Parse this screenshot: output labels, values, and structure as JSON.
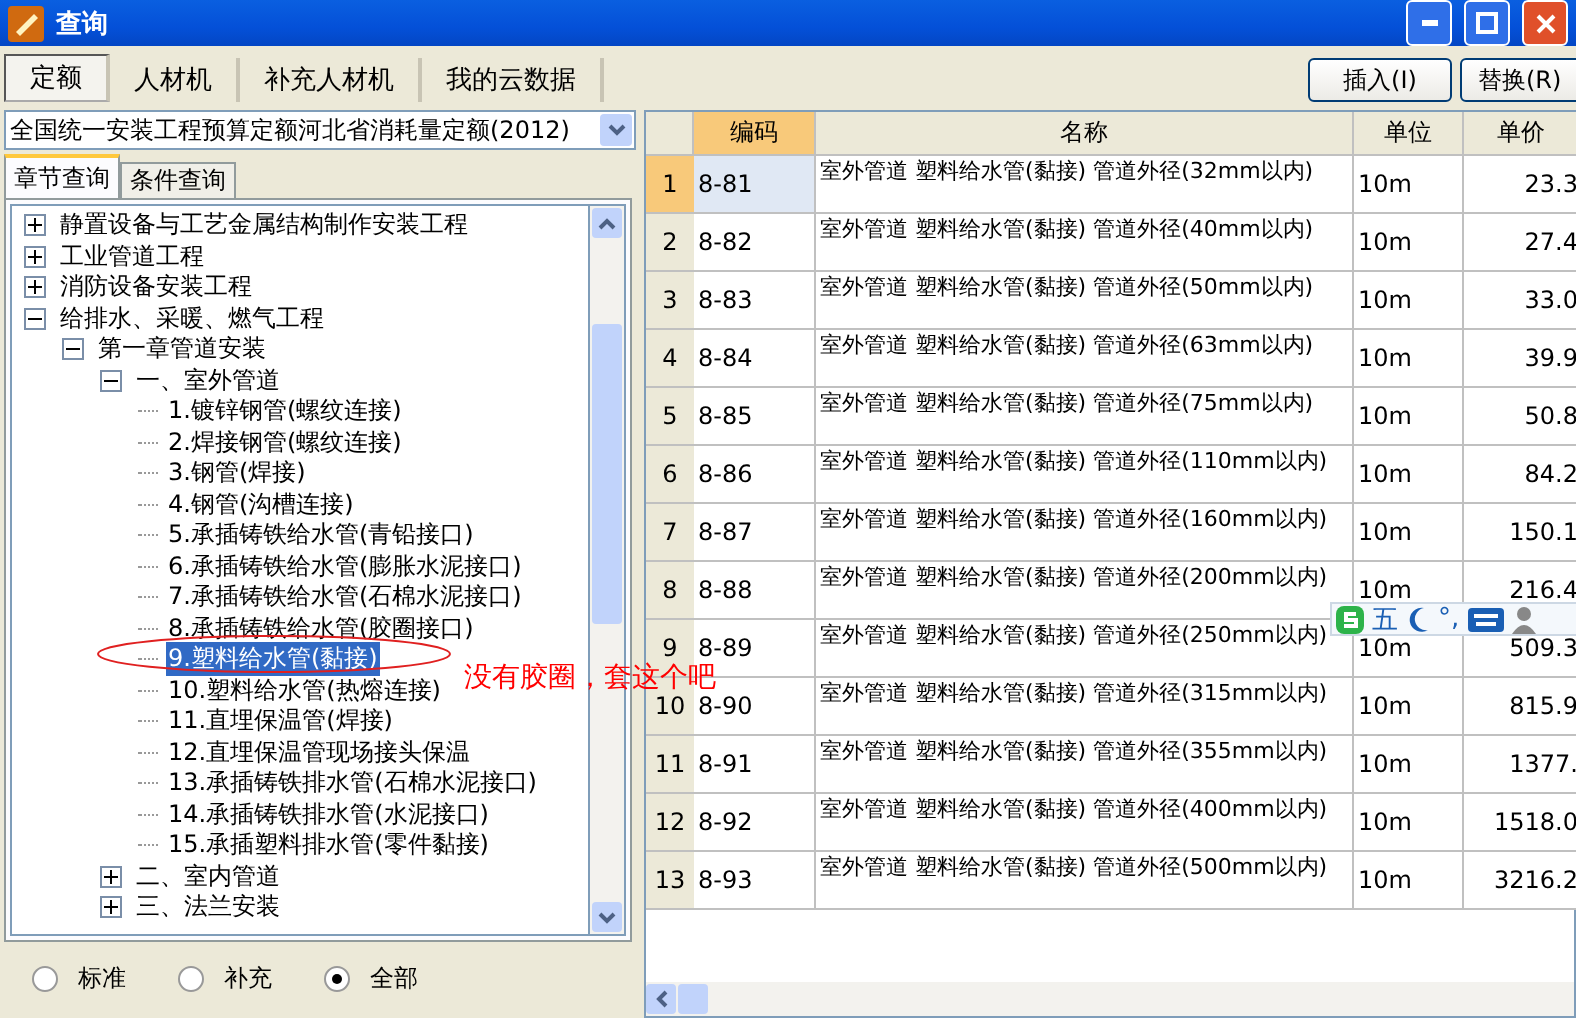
{
  "window": {
    "title": "查询"
  },
  "top_tabs": [
    {
      "label": "定额",
      "selected": true
    },
    {
      "label": "人材机",
      "selected": false
    },
    {
      "label": "补充人材机",
      "selected": false
    },
    {
      "label": "我的云数据",
      "selected": false
    }
  ],
  "buttons": [
    "插入(I)",
    "替换(R)"
  ],
  "quota_select": {
    "value": "全国统一安装工程预算定额河北省消耗量定额(2012)"
  },
  "sub_tabs": [
    {
      "label": "章节查询",
      "selected": true
    },
    {
      "label": "条件查询",
      "selected": false
    }
  ],
  "tree": [
    {
      "label": "静置设备与工艺金属结构制作安装工程",
      "expanded": false,
      "selected": false
    },
    {
      "label": "工业管道工程",
      "expanded": false,
      "selected": false
    },
    {
      "label": "消防设备安装工程",
      "expanded": false,
      "selected": false
    },
    {
      "label": "给排水、采暖、燃气工程",
      "expanded": true,
      "selected": false,
      "children": [
        {
          "label": "第一章管道安装",
          "expanded": true,
          "selected": false,
          "children": [
            {
              "label": "一、室外管道",
              "expanded": true,
              "selected": false,
              "children": [
                {
                  "label": "1.镀锌钢管(螺纹连接)",
                  "selected": false
                },
                {
                  "label": "2.焊接钢管(螺纹连接)",
                  "selected": false
                },
                {
                  "label": "3.钢管(焊接)",
                  "selected": false
                },
                {
                  "label": "4.钢管(沟槽连接)",
                  "selected": false
                },
                {
                  "label": "5.承插铸铁给水管(青铅接口)",
                  "selected": false
                },
                {
                  "label": "6.承插铸铁给水管(膨胀水泥接口)",
                  "selected": false
                },
                {
                  "label": "7.承插铸铁给水管(石棉水泥接口)",
                  "selected": false
                },
                {
                  "label": "8.承插铸铁给水管(胶圈接口)",
                  "selected": false
                },
                {
                  "label": "9.塑料给水管(黏接)",
                  "selected": true
                },
                {
                  "label": "10.塑料给水管(热熔连接)",
                  "selected": false
                },
                {
                  "label": "11.直埋保温管(焊接)",
                  "selected": false
                },
                {
                  "label": "12.直埋保温管现场接头保温",
                  "selected": false
                },
                {
                  "label": "13.承插铸铁排水管(石棉水泥接口)",
                  "selected": false
                },
                {
                  "label": "14.承插铸铁排水管(水泥接口)",
                  "selected": false
                },
                {
                  "label": "15.承插塑料排水管(零件黏接)",
                  "selected": false
                }
              ]
            },
            {
              "label": "二、室内管道",
              "expanded": false,
              "selected": false
            },
            {
              "label": "三、法兰安装",
              "expanded": false,
              "selected": false
            }
          ]
        }
      ]
    }
  ],
  "filter_radios": [
    {
      "label": "标准",
      "selected": false
    },
    {
      "label": "补充",
      "selected": false
    },
    {
      "label": "全部",
      "selected": true
    }
  ],
  "table": {
    "columns": [
      "编码",
      "名称",
      "单位",
      "单价"
    ],
    "rows": [
      {
        "index": "1",
        "code": "8-81",
        "name": "室外管道 塑料给水管(黏接) 管道外径(32mm以内)",
        "unit": "10m",
        "price": "23.3",
        "selected": true
      },
      {
        "index": "2",
        "code": "8-82",
        "name": "室外管道 塑料给水管(黏接) 管道外径(40mm以内)",
        "unit": "10m",
        "price": "27.4",
        "selected": false
      },
      {
        "index": "3",
        "code": "8-83",
        "name": "室外管道 塑料给水管(黏接) 管道外径(50mm以内)",
        "unit": "10m",
        "price": "33.0",
        "selected": false
      },
      {
        "index": "4",
        "code": "8-84",
        "name": "室外管道 塑料给水管(黏接) 管道外径(63mm以内)",
        "unit": "10m",
        "price": "39.9",
        "selected": false
      },
      {
        "index": "5",
        "code": "8-85",
        "name": "室外管道 塑料给水管(黏接) 管道外径(75mm以内)",
        "unit": "10m",
        "price": "50.8",
        "selected": false
      },
      {
        "index": "6",
        "code": "8-86",
        "name": "室外管道 塑料给水管(黏接) 管道外径(110mm以内)",
        "unit": "10m",
        "price": "84.2",
        "selected": false
      },
      {
        "index": "7",
        "code": "8-87",
        "name": "室外管道 塑料给水管(黏接) 管道外径(160mm以内)",
        "unit": "10m",
        "price": "150.1",
        "selected": false
      },
      {
        "index": "8",
        "code": "8-88",
        "name": "室外管道 塑料给水管(黏接) 管道外径(200mm以内)",
        "unit": "10m",
        "price": "216.4",
        "selected": false
      },
      {
        "index": "9",
        "code": "8-89",
        "name": "室外管道 塑料给水管(黏接) 管道外径(250mm以内)",
        "unit": "10m",
        "price": "509.3",
        "selected": false
      },
      {
        "index": "10",
        "code": "8-90",
        "name": "室外管道 塑料给水管(黏接) 管道外径(315mm以内)",
        "unit": "10m",
        "price": "815.9",
        "selected": false
      },
      {
        "index": "11",
        "code": "8-91",
        "name": "室外管道 塑料给水管(黏接) 管道外径(355mm以内)",
        "unit": "10m",
        "price": "1377.",
        "selected": false
      },
      {
        "index": "12",
        "code": "8-92",
        "name": "室外管道 塑料给水管(黏接) 管道外径(400mm以内)",
        "unit": "10m",
        "price": "1518.0",
        "selected": false
      },
      {
        "index": "13",
        "code": "8-93",
        "name": "室外管道 塑料给水管(黏接) 管道外径(500mm以内)",
        "unit": "10m",
        "price": "3216.2",
        "selected": false
      }
    ]
  },
  "annotation": {
    "text": "没有胶圈，套这个吧"
  },
  "ime_toolbar": {
    "mode": "五",
    "punctuation": "°,"
  }
}
